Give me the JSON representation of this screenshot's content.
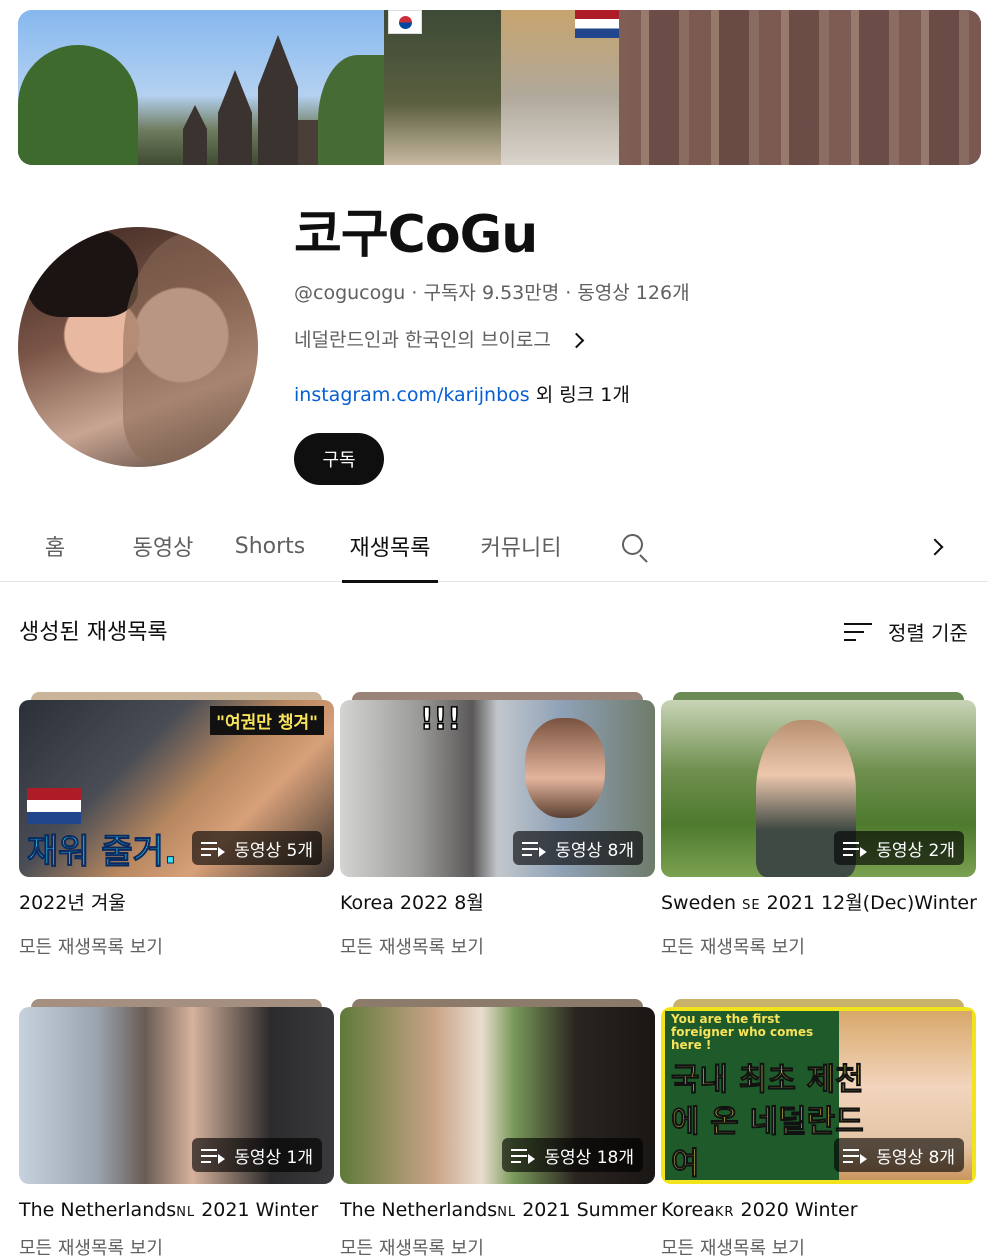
{
  "channel": {
    "name": "코구CoGu",
    "meta": "@cogucogu · 구독자 9.53만명 · 동영상 126개",
    "description": "네덜란드인과 한국인의 브이로그",
    "link_url": "instagram.com/karijnbos",
    "link_more": "외 링크 1개",
    "subscribe_label": "구독"
  },
  "tabs": [
    {
      "label": "홈",
      "active": false
    },
    {
      "label": "동영상",
      "active": false
    },
    {
      "label": "Shorts",
      "active": false
    },
    {
      "label": "재생목록",
      "active": true
    },
    {
      "label": "커뮤니티",
      "active": false
    }
  ],
  "section": {
    "title": "생성된 재생목록",
    "sort_label": "정렬 기준"
  },
  "playlists": [
    {
      "title": "2022년 겨울",
      "title_suffix": "",
      "title_tail": "",
      "count": "동영상 5개",
      "link": "모든 재생목록 보기",
      "overlay_top": "\"여권만 챙겨\"",
      "overlay_bottom": "재워 줄거."
    },
    {
      "title": "Korea 2022 8월",
      "title_suffix": "",
      "title_tail": "",
      "count": "동영상 8개",
      "link": "모든 재생목록 보기",
      "overlay_top": "!!!",
      "overlay_bottom": ""
    },
    {
      "title": "Sweden ",
      "title_suffix": "SE",
      "title_tail": " 2021 12월(Dec)Winter",
      "count": "동영상 2개",
      "link": "모든 재생목록 보기",
      "overlay_top": "",
      "overlay_bottom": ""
    },
    {
      "title": "The Netherlands",
      "title_suffix": "NL",
      "title_tail": " 2021 Winter",
      "count": "동영상 1개",
      "link": "모든 재생목록 보기",
      "overlay_top": "",
      "overlay_bottom": ""
    },
    {
      "title": "The Netherlands",
      "title_suffix": "NL",
      "title_tail": " 2021 Summer",
      "count": "동영상 18개",
      "link": "모든 재생목록 보기",
      "overlay_top": "",
      "overlay_bottom": ""
    },
    {
      "title": "Korea",
      "title_suffix": "KR",
      "title_tail": " 2020 Winter",
      "count": "동영상 8개",
      "link": "모든 재생목록 보기",
      "overlay_top": "You are the first foreigner who comes here !",
      "overlay_bottom": "국내 최초 제천에 온 네덜란드 여"
    }
  ],
  "icons": {
    "search": "search-icon",
    "next": "chevron-right-icon",
    "sort": "sort-icon",
    "playlist": "playlist-icon"
  },
  "colors": {
    "link": "#065fd4",
    "subscribe_bg": "#0f0f0f",
    "secondary_text": "#606060"
  }
}
